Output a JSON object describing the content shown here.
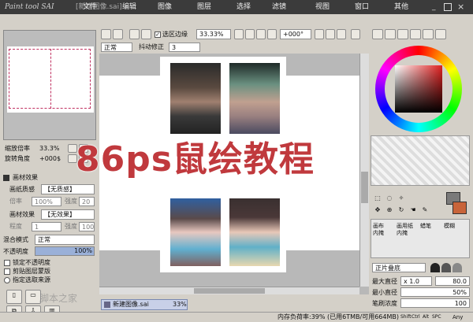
{
  "app": {
    "logo_text": "Paint tool SAI",
    "doc_title": "[新建图像.sai]",
    "title_bar_color": "#3b3b3b"
  },
  "menu": [
    "文件",
    "编辑",
    "图像",
    "图层",
    "选择",
    "滤镜",
    "视图",
    "窗口",
    "其他"
  ],
  "toolbar": {
    "select_edge_label": "选区边缘",
    "zoom_value": "33.33%",
    "rotate_value": "+000°"
  },
  "toolbar2": {
    "mode_value": "正常",
    "stabilizer_label": "抖动修正",
    "stabilizer_value": "3"
  },
  "navigator": {
    "zoom_label": "缩放倍率",
    "zoom_value": "33.3%",
    "rotate_label": "旋转角度",
    "rotate_value": "+000$"
  },
  "texture_panel": {
    "section_label": "画材效果",
    "paper_label": "画纸质感",
    "paper_value": "【无质感】",
    "scale_label": "倍率",
    "scale_value": "100%",
    "strength_label": "强度",
    "strength_value": "20",
    "effect_label": "画材效果",
    "effect_value": "【无效果】",
    "width_label": "程度",
    "width_value": "1",
    "strength2_label": "强度",
    "strength2_value": "100"
  },
  "layer_panel": {
    "blend_label": "混合模式",
    "blend_value": "正常",
    "opacity_label": "不透明度",
    "opacity_value": "100%",
    "opacity_fraction": 1.0,
    "lock_label": "锁定不透明度",
    "clip_label": "剪贴图层蒙版",
    "source_label": "指定选取来源"
  },
  "overlay_text": "86ps鼠绘教程",
  "watermark_text": "脚本之家",
  "doc_tab": {
    "name": "新建图像.sai",
    "zoom": "33%"
  },
  "tools": {
    "row1": [
      "画布\n内掩",
      "画用纸\n内掩",
      "蜡笔",
      "模糊"
    ],
    "blend_value": "正片叠底"
  },
  "brush": {
    "max_size_label": "最大直径",
    "max_size_mult": "x 1.0",
    "max_size_value": "80.0",
    "min_size_label": "最小直径",
    "min_size_value": "50%",
    "density_label": "笔刷浓度",
    "density_value": "100"
  },
  "status": {
    "memory_text": "内存负荷率:39% (已用6TMB/可用664MB)",
    "keys": [
      "Shift",
      "Ctrl",
      "Alt",
      "SPC"
    ],
    "any_label": "Any"
  },
  "colors": {
    "accent_red": "#c0393d",
    "panel_bg": "#d4d0c8",
    "canvas_bg": "#b8b8b8",
    "fg_swatch": "#7a7a7a",
    "bg_swatch": "#c8643a"
  }
}
